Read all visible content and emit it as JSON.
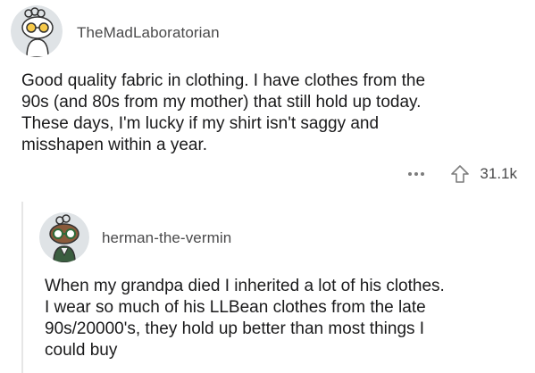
{
  "comments": [
    {
      "username": "TheMadLaboratorian",
      "avatar_icon": "reddit-snoo-avatar-icon",
      "body_lines": [
        "Good quality fabric in clothing.  I have clothes from the",
        "90s (and 80s from my mother) that still hold up today.",
        "These days, I'm lucky if my shirt isn't saggy and",
        "misshapen within a year."
      ],
      "more_icon": "more-options-icon",
      "upvote_icon": "upvote-arrow-icon",
      "score": "31.1k"
    },
    {
      "username": "herman-the-vermin",
      "avatar_icon": "reddit-snoo-avatar-icon",
      "body_lines": [
        "When my grandpa died I inherited a lot of his clothes.",
        "I wear so much of his LLBean clothes from the late",
        "90s/20000's, they hold up better than most things I",
        "could buy"
      ]
    }
  ],
  "colors": {
    "text": "#1a1a1b",
    "meta": "#4a4a4b",
    "thread_line": "#e6e6e6",
    "avatar_bg": "#dfe3e6"
  }
}
